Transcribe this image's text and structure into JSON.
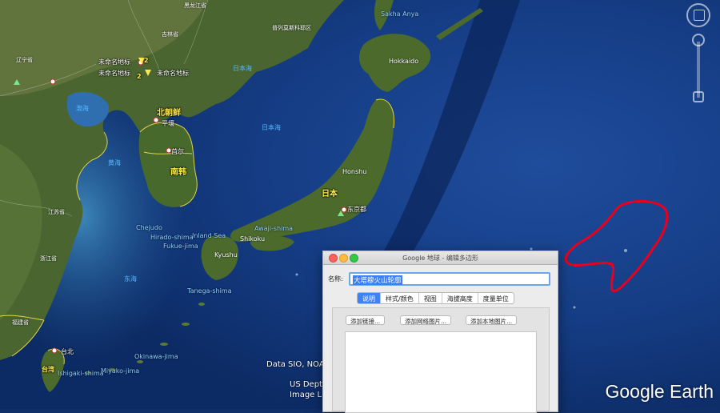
{
  "map": {
    "places": {
      "heilongjiang": "黑龙江省",
      "jilin": "吉林省",
      "liaoning": "辽宁省",
      "primorsky": "普列莫斯科耶区",
      "sakhalin": "Sakha Anya",
      "unnamed1": "未命名地标",
      "unnamed2": "未命名地标",
      "unnamed3": "未命名地标",
      "unnamed_num1": "2",
      "unnamed_num2": "2",
      "pyongyang": "平壤",
      "seoul": "首尔",
      "tokyo": "东京都",
      "taipei": "台北",
      "north_korea": "北朝鲜",
      "south_korea": "南韩",
      "japan": "日本",
      "hokkaido": "Hokkaido",
      "honshu": "Honshu",
      "shikoku": "Shikoku",
      "kyushu": "Kyushu",
      "bohai": "渤海",
      "yellow_sea": "黄海",
      "east_sea": "东海",
      "sea_of_japan": "日本海",
      "sea_of_japan_top": "日本海",
      "inland_sea": "Inland Sea",
      "jeju": "Chejudo",
      "hirado": "Hirado-shima",
      "fukue": "Fukue-jima",
      "awaji": "Awaji-shima",
      "tanegashima": "Tanega-shima",
      "okinawa": "Okinawa-jima",
      "ishigaki": "Ishigaki-shima",
      "miyako": "Miyako-jima",
      "zhejiang": "浙江省",
      "fujian": "福建省",
      "jiangsu": "江苏省",
      "taiwan": "台湾"
    },
    "attribution": [
      "Data SIO, NOAA",
      "US Dept",
      "Image L"
    ],
    "logo": "Google Earth"
  },
  "dialog": {
    "title": "Google 地球 - 编辑多边形",
    "name_label": "名称:",
    "name_value": "大塔穆火山轮廓",
    "tabs": [
      "说明",
      "样式/颜色",
      "视图",
      "海拔高度",
      "度量单位"
    ],
    "active_tab": "说明",
    "buttons": [
      "添加链接...",
      "添加网络图片...",
      "添加本地图片..."
    ]
  },
  "colors": {
    "polygon": "#e8001c",
    "ocean": "#10306a",
    "land": "#3d5a2a",
    "border": "#ffe84a",
    "tab_active": "#3d83f7"
  },
  "icons": [
    "compass-ring-icon",
    "look-around-icon",
    "zoom-in-icon",
    "zoom-out-icon",
    "placemark-icon",
    "close-window-icon",
    "minimize-window-icon",
    "zoom-window-icon"
  ]
}
